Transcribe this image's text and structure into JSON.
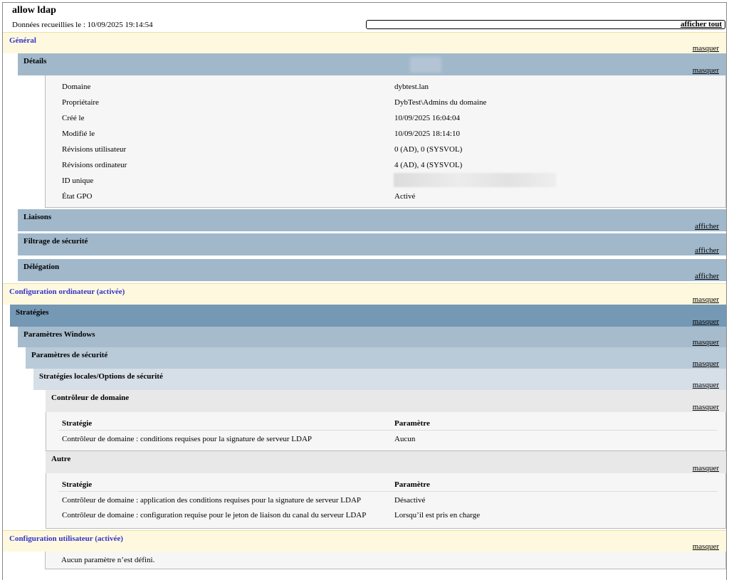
{
  "header": {
    "title": "allow ldap",
    "collected": "Données recueillies le : 10/09/2025 19:14:54",
    "show_all": "afficher tout"
  },
  "general": {
    "label": "Général",
    "toggle": "masquer",
    "details": {
      "label": "Détails",
      "toggle": "masquer",
      "rows": [
        {
          "key": "Domaine",
          "value": "dybtest.lan"
        },
        {
          "key": "Propriétaire",
          "value": "DybTest\\Admins du domaine"
        },
        {
          "key": "Créé le",
          "value": "10/09/2025 16:04:04"
        },
        {
          "key": "Modifié le",
          "value": "10/09/2025 18:14:10"
        },
        {
          "key": "Révisions utilisateur",
          "value": "0 (AD), 0 (SYSVOL)"
        },
        {
          "key": "Révisions ordinateur",
          "value": "4 (AD), 4 (SYSVOL)"
        },
        {
          "key": "ID unique",
          "value": ""
        },
        {
          "key": "État GPO",
          "value": "Activé"
        }
      ]
    },
    "links": {
      "label": "Liaisons",
      "toggle": "afficher"
    },
    "security_filtering": {
      "label": "Filtrage de sécurité",
      "toggle": "afficher"
    },
    "delegation": {
      "label": "Délégation",
      "toggle": "afficher"
    }
  },
  "computer_config": {
    "label": "Configuration ordinateur (activée)",
    "toggle": "masquer",
    "policies": {
      "label": "Stratégies",
      "toggle": "masquer"
    },
    "windows_settings": {
      "label": "Paramètres Windows",
      "toggle": "masquer"
    },
    "security_settings": {
      "label": "Paramètres de sécurité",
      "toggle": "masquer"
    },
    "local_policies": {
      "label": "Stratégies locales/Options de sécurité",
      "toggle": "masquer"
    },
    "domain_controller": {
      "label": "Contrôleur de domaine",
      "toggle": "masquer",
      "col_policy": "Stratégie",
      "col_setting": "Paramètre",
      "rows": [
        {
          "policy": "Contrôleur de domaine : conditions requises pour la signature de serveur LDAP",
          "setting": "Aucun"
        }
      ]
    },
    "other": {
      "label": "Autre",
      "toggle": "masquer",
      "col_policy": "Stratégie",
      "col_setting": "Paramètre",
      "rows": [
        {
          "policy": "Contrôleur de domaine : application des conditions requises pour la signature de serveur LDAP",
          "setting": "Désactivé"
        },
        {
          "policy": "Contrôleur de domaine : configuration requise pour le jeton de liaison du canal du serveur LDAP",
          "setting": "Lorsqu’il est pris en charge"
        }
      ]
    }
  },
  "user_config": {
    "label": "Configuration utilisateur (activée)",
    "toggle": "masquer",
    "empty_message": "Aucun paramètre n’est défini."
  }
}
